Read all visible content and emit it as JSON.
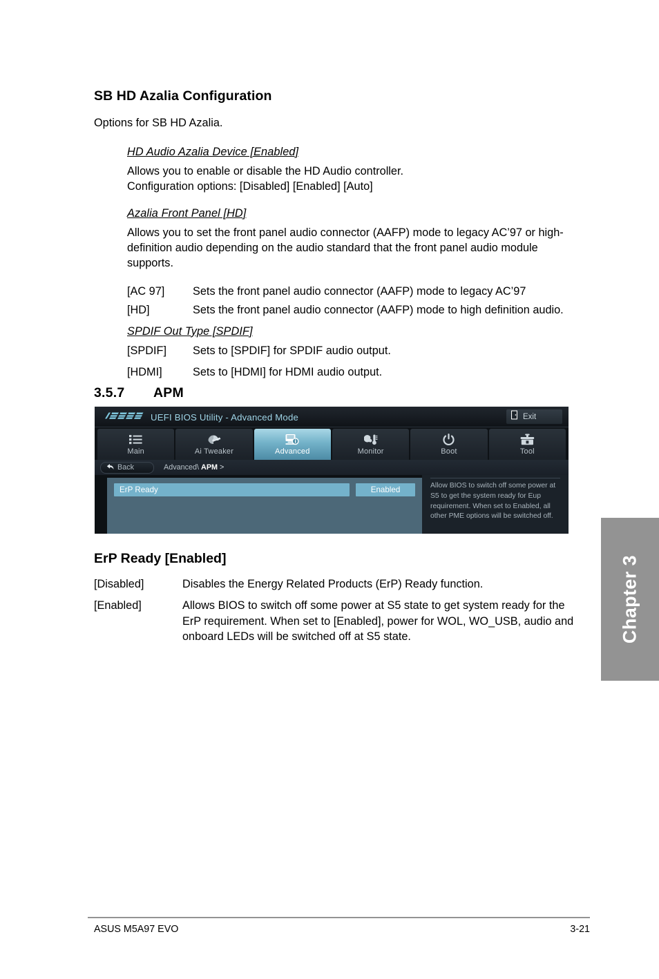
{
  "document": {
    "section_azalia": {
      "heading": "SB HD Azalia Configuration",
      "lead": "Options for SB HD Azalia.",
      "items": [
        {
          "title": "HD Audio Azalia Device [Enabled]",
          "lines": [
            "Allows you to enable or disable the HD Audio controller.",
            "Configuration options: [Disabled] [Enabled] [Auto]"
          ]
        },
        {
          "title": "Azalia Front Panel [HD]",
          "lines": [
            "Allows you to set the front panel audio connector (AAFP) mode to legacy AC’97 or high-definition audio depending on the audio standard that the front panel audio module supports."
          ],
          "definitions": [
            {
              "term": "[AC 97]",
              "desc": "Sets the front panel audio connector (AAFP) mode to legacy AC’97"
            },
            {
              "term": "[HD]",
              "desc": "Sets the front panel audio connector (AAFP) mode to high definition audio."
            }
          ]
        },
        {
          "title": "SPDIF Out Type [SPDIF]",
          "lines": [],
          "definitions": [
            {
              "term": "[SPDIF]",
              "desc": "Sets to [SPDIF] for SPDIF audio output."
            },
            {
              "term": "[HDMI]",
              "desc": "Sets to [HDMI] for HDMI audio output."
            }
          ]
        }
      ]
    },
    "section_apm": {
      "number": "3.5.7",
      "title": "APM"
    },
    "section_erp": {
      "heading": "ErP Ready [Enabled]",
      "definitions": [
        {
          "term": "[Disabled]",
          "desc": "Disables the Energy Related Products (ErP) Ready function."
        },
        {
          "term": "[Enabled]",
          "desc": "Allows BIOS to switch off some power at S5 state to get system ready for the ErP requirement. When set to [Enabled], power for WOL, WO_USB, audio and onboard LEDs will be switched off at S5 state."
        }
      ]
    }
  },
  "chapter_tab": {
    "label": "Chapter 3"
  },
  "bios": {
    "brand": "ASUS",
    "title": "UEFI BIOS Utility - Advanced Mode",
    "exit_label": "Exit",
    "tabs": [
      {
        "label": "Main",
        "icon": "list-icon",
        "active": false
      },
      {
        "label": "Ai  Tweaker",
        "icon": "speedometer-icon",
        "active": false
      },
      {
        "label": "Advanced",
        "icon": "advanced-info-icon",
        "active": true
      },
      {
        "label": "Monitor",
        "icon": "thermometer-gauge-icon",
        "active": false
      },
      {
        "label": "Boot",
        "icon": "power-icon",
        "active": false
      },
      {
        "label": "Tool",
        "icon": "toolbox-icon",
        "active": false
      }
    ],
    "back_label": "Back",
    "breadcrumb": {
      "parent": "Advanced\\",
      "current": "APM",
      "arrow": ">"
    },
    "rows": [
      {
        "name": "ErP Ready",
        "value": "Enabled"
      }
    ],
    "help_text": "Allow BIOS to switch off some power at S5 to get the system ready for Eup requirement. When set to Enabled, all other PME options will be switched off.",
    "colors": {
      "accent_cyan": "#9fd4e6",
      "row_highlight": "#74b2cb",
      "list_bg": "#4c6878",
      "panel_bg": "#0d1114"
    }
  },
  "footer": {
    "left": "ASUS M5A97 EVO",
    "right": "3-21"
  }
}
